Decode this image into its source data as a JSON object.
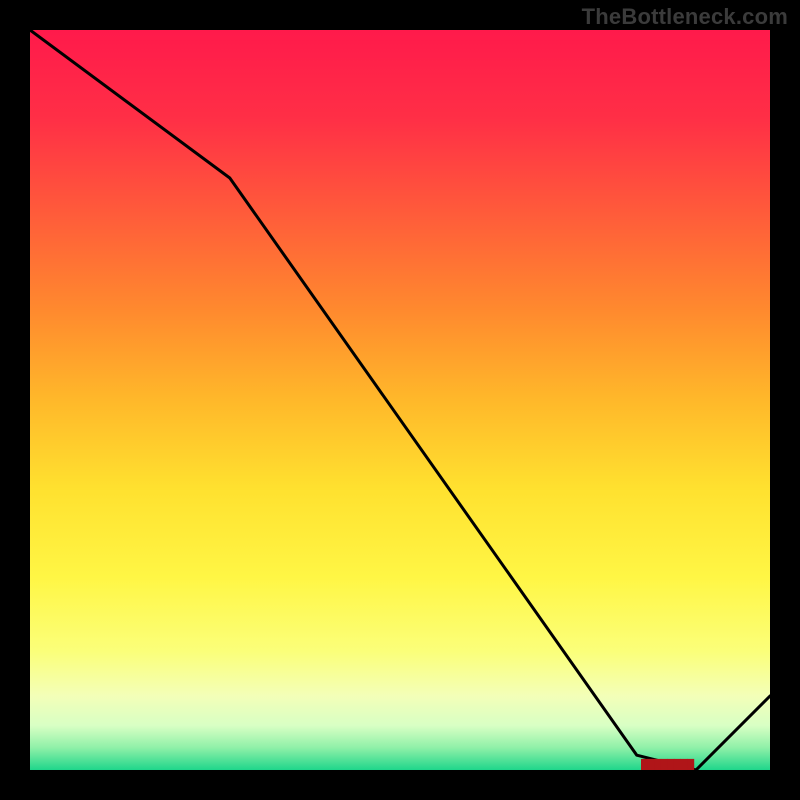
{
  "watermark": "TheBottleneck.com",
  "chart_data": {
    "type": "line",
    "x": [
      0.0,
      0.27,
      0.82,
      0.9,
      1.0
    ],
    "values": [
      1.0,
      0.8,
      0.02,
      0.0,
      0.1
    ],
    "xlim": [
      0,
      1
    ],
    "ylim": [
      0,
      1
    ],
    "title": "",
    "xlabel": "",
    "ylabel": "",
    "background": "rainbow-vertical",
    "legend": false
  },
  "gradient_stops": [
    {
      "offset": "0%",
      "color": "#ff1a4b"
    },
    {
      "offset": "12%",
      "color": "#ff2f46"
    },
    {
      "offset": "25%",
      "color": "#ff5c3a"
    },
    {
      "offset": "38%",
      "color": "#ff8a2e"
    },
    {
      "offset": "50%",
      "color": "#ffb82a"
    },
    {
      "offset": "62%",
      "color": "#ffe12f"
    },
    {
      "offset": "74%",
      "color": "#fff645"
    },
    {
      "offset": "84%",
      "color": "#fbff7a"
    },
    {
      "offset": "90%",
      "color": "#f3ffb8"
    },
    {
      "offset": "94%",
      "color": "#d8ffc4"
    },
    {
      "offset": "97%",
      "color": "#8ff0a8"
    },
    {
      "offset": "100%",
      "color": "#1fd68b"
    }
  ],
  "line_color": "#000000",
  "line_width": 3,
  "bottom_marker_text": "████████"
}
